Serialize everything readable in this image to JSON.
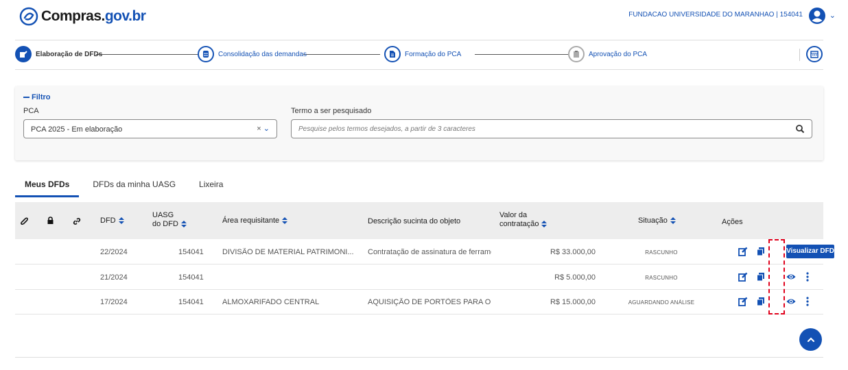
{
  "header": {
    "logo_text_a": "Compras.",
    "logo_text_b": "gov.br",
    "org": "FUNDACAO UNIVERSIDADE DO MARANHAO | 154041"
  },
  "stepper": {
    "steps": [
      {
        "label": "Elaboração de DFDs",
        "state": "active",
        "icon": "edit-icon"
      },
      {
        "label": "Consolidação das demandas",
        "state": "pending",
        "icon": "database-icon"
      },
      {
        "label": "Formação do PCA",
        "state": "pending",
        "icon": "document-icon"
      },
      {
        "label": "Aprovação do PCA",
        "state": "disabled",
        "icon": "clipboard-icon"
      }
    ],
    "calendar_icon": "calendar-icon"
  },
  "filter": {
    "toggle_label": "Filtro",
    "pca_label": "PCA",
    "pca_value": "PCA 2025 - Em elaboração",
    "search_label": "Termo a ser pesquisado",
    "search_placeholder": "Pesquise pelos termos desejados, a partir de 3 caracteres"
  },
  "tabs": [
    {
      "label": "Meus DFDs",
      "active": true
    },
    {
      "label": "DFDs da minha UASG",
      "active": false
    },
    {
      "label": "Lixeira",
      "active": false
    }
  ],
  "table": {
    "headers": {
      "dfd": "DFD",
      "uasg_a": "UASG",
      "uasg_b": "do DFD",
      "area": "Área requisitante",
      "desc": "Descrição sucinta do objeto",
      "valor_a": "Valor da",
      "valor_b": "contratação",
      "situacao": "Situação",
      "acoes": "Ações"
    },
    "rows": [
      {
        "dfd": "22/2024",
        "uasg": "154041",
        "area": "DIVISÃO DE MATERIAL PATRIMONI...",
        "desc": "Contratação de assinatura de ferrame...",
        "valor": "R$ 33.000,00",
        "situacao": "RASCUNHO"
      },
      {
        "dfd": "21/2024",
        "uasg": "154041",
        "area": "",
        "desc": "",
        "valor": "R$ 5.000,00",
        "situacao": "RASCUNHO"
      },
      {
        "dfd": "17/2024",
        "uasg": "154041",
        "area": "ALMOXARIFADO CENTRAL",
        "desc": "AQUISIÇÃO DE PORTÕES PARA O AL...",
        "valor": "R$ 15.000,00",
        "situacao": "AGUARDANDO ANÁLISE"
      }
    ]
  },
  "tooltip": "Visualizar DFD",
  "colors": {
    "primary": "#1351b4",
    "highlight": "#e0001b"
  }
}
